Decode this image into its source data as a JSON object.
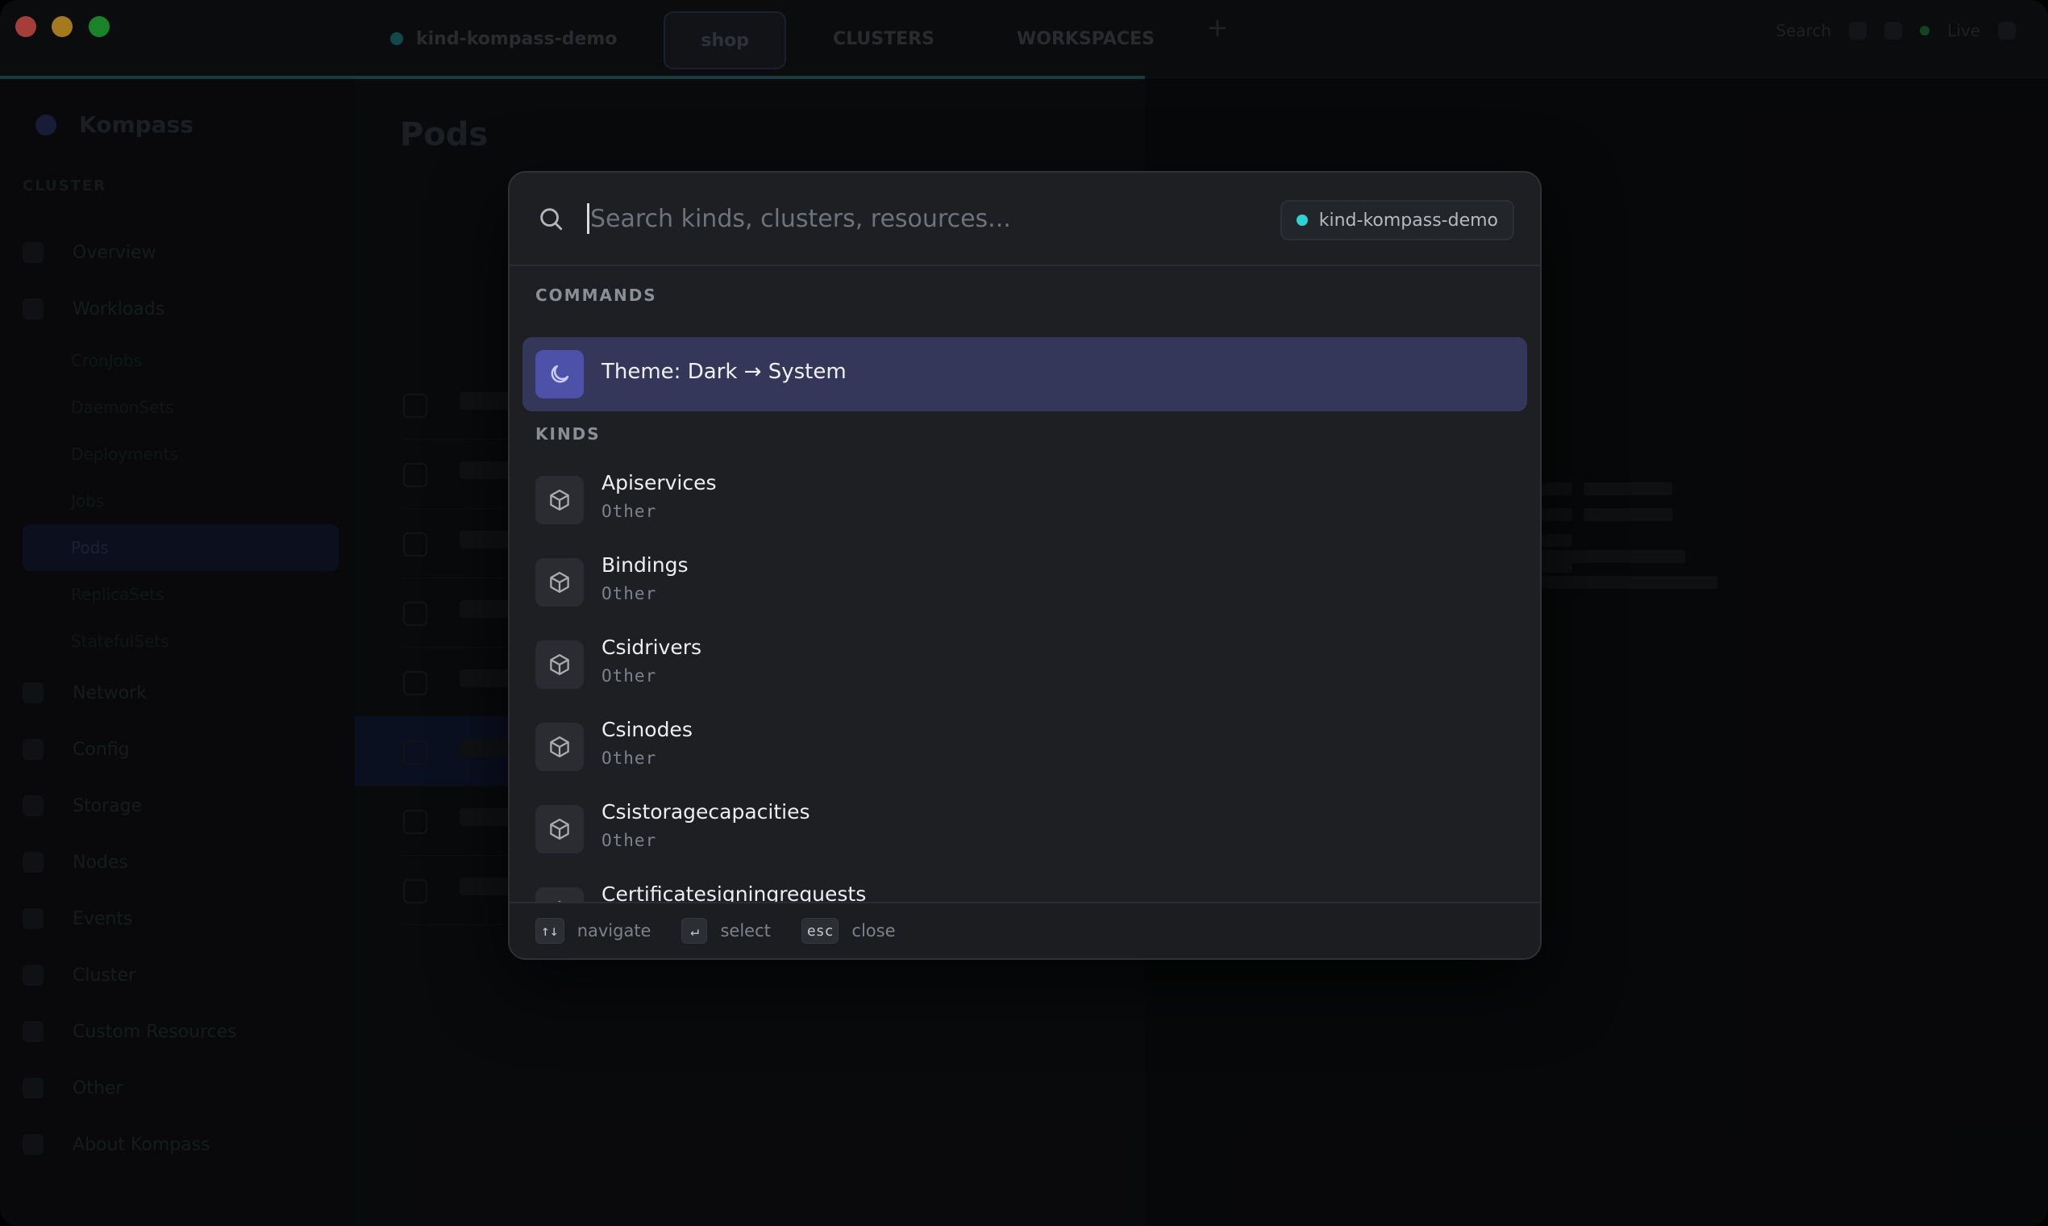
{
  "window": {
    "tabs": [
      {
        "label": "kind-kompass-demo",
        "active": false
      },
      {
        "label": "shop",
        "active": true
      },
      {
        "label": "CLUSTERS",
        "active": false
      },
      {
        "label": "WORKSPACES",
        "active": false
      }
    ],
    "tab_add": "+",
    "top_right": {
      "search": "Search",
      "status": "Live"
    }
  },
  "sidebar": {
    "app_name": "Kompass",
    "section": "CLUSTER",
    "items": [
      {
        "label": "Overview"
      },
      {
        "label": "Workloads"
      },
      {
        "label": "Network"
      },
      {
        "label": "Config"
      },
      {
        "label": "Storage"
      },
      {
        "label": "Nodes"
      },
      {
        "label": "Events"
      },
      {
        "label": "Cluster"
      },
      {
        "label": "Custom Resources"
      },
      {
        "label": "Other"
      }
    ],
    "workload_subitems": [
      "CronJobs",
      "DaemonSets",
      "Deployments",
      "Jobs",
      "Pods",
      "ReplicaSets",
      "StatefulSets"
    ],
    "footer": "About Kompass"
  },
  "main": {
    "title": "Pods"
  },
  "palette": {
    "search_placeholder": "Search kinds, clusters, resources...",
    "context": {
      "label": "kind-kompass-demo",
      "color": "#2dd4cf"
    },
    "groups": {
      "commands": "COMMANDS",
      "kinds": "KINDS"
    },
    "commands": [
      {
        "label": "Theme: Dark → System",
        "icon": "moon-icon",
        "selected": true
      }
    ],
    "kinds": [
      {
        "name": "Apiservices",
        "category": "Other",
        "icon": "cube-icon"
      },
      {
        "name": "Bindings",
        "category": "Other",
        "icon": "cube-icon"
      },
      {
        "name": "Csidrivers",
        "category": "Other",
        "icon": "cube-icon"
      },
      {
        "name": "Csinodes",
        "category": "Other",
        "icon": "cube-icon"
      },
      {
        "name": "Csistoragecapacities",
        "category": "Other",
        "icon": "cube-icon"
      },
      {
        "name": "Certificatesigningrequests",
        "category": "",
        "icon": "cube-icon"
      }
    ],
    "footer": {
      "navigate_key": "↑↓",
      "navigate_label": "navigate",
      "select_key": "↵",
      "select_label": "select",
      "close_key": "esc",
      "close_label": "close"
    }
  },
  "colors": {
    "accent": "#4d52a8",
    "selected_row": "#35375a",
    "context_dot": "#2dd4cf"
  }
}
